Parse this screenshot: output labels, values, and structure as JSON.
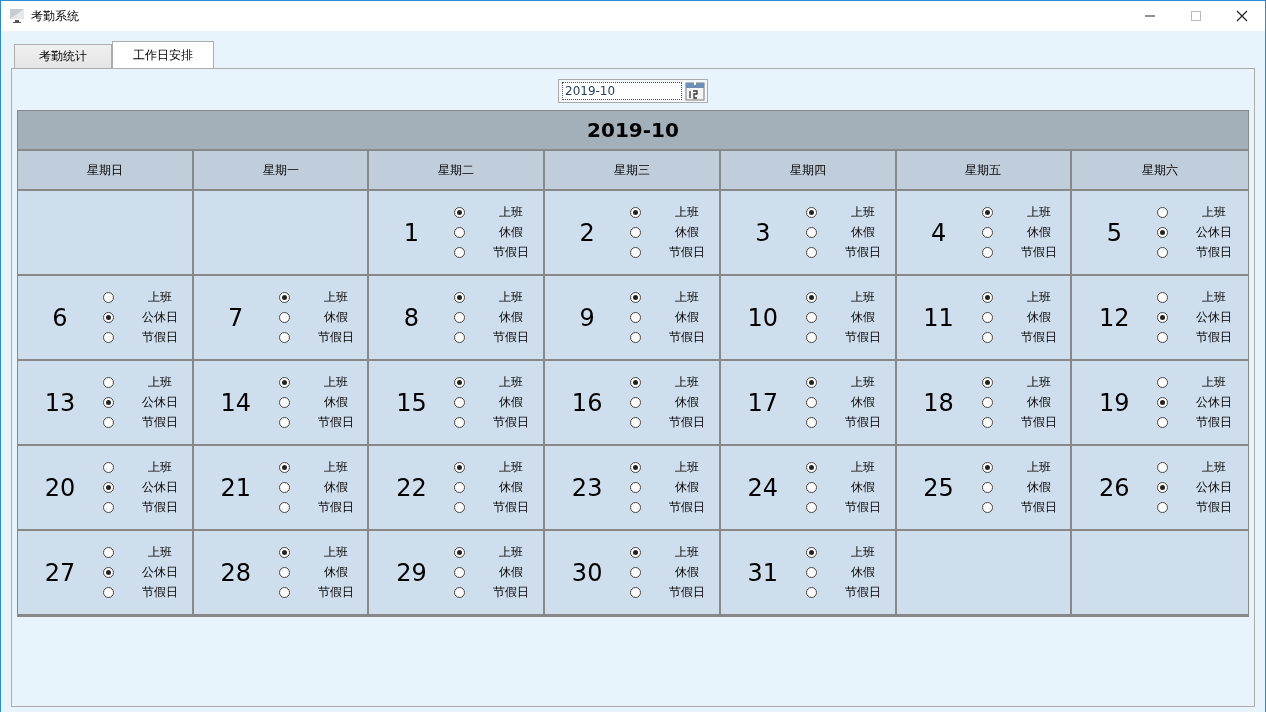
{
  "window": {
    "title": "考勤系统"
  },
  "tabs": [
    {
      "label": "考勤统计",
      "selected": false
    },
    {
      "label": "工作日安排",
      "selected": true
    }
  ],
  "month_picker": {
    "value": "2019-10"
  },
  "calendar": {
    "title": "2019-10",
    "weekdays": [
      "星期日",
      "星期一",
      "星期二",
      "星期三",
      "星期四",
      "星期五",
      "星期六"
    ],
    "cells": [
      {
        "kind": "blank"
      },
      {
        "kind": "blank"
      },
      {
        "kind": "day",
        "day": "1",
        "options": [
          {
            "label": "上班",
            "selected": true
          },
          {
            "label": "休假",
            "selected": false
          },
          {
            "label": "节假日",
            "selected": false
          }
        ]
      },
      {
        "kind": "day",
        "day": "2",
        "options": [
          {
            "label": "上班",
            "selected": true
          },
          {
            "label": "休假",
            "selected": false
          },
          {
            "label": "节假日",
            "selected": false
          }
        ]
      },
      {
        "kind": "day",
        "day": "3",
        "options": [
          {
            "label": "上班",
            "selected": true
          },
          {
            "label": "休假",
            "selected": false
          },
          {
            "label": "节假日",
            "selected": false
          }
        ]
      },
      {
        "kind": "day",
        "day": "4",
        "options": [
          {
            "label": "上班",
            "selected": true
          },
          {
            "label": "休假",
            "selected": false
          },
          {
            "label": "节假日",
            "selected": false
          }
        ]
      },
      {
        "kind": "day",
        "day": "5",
        "options": [
          {
            "label": "上班",
            "selected": false
          },
          {
            "label": "公休日",
            "selected": true
          },
          {
            "label": "节假日",
            "selected": false
          }
        ]
      },
      {
        "kind": "day",
        "day": "6",
        "options": [
          {
            "label": "上班",
            "selected": false
          },
          {
            "label": "公休日",
            "selected": true
          },
          {
            "label": "节假日",
            "selected": false
          }
        ]
      },
      {
        "kind": "day",
        "day": "7",
        "options": [
          {
            "label": "上班",
            "selected": true
          },
          {
            "label": "休假",
            "selected": false
          },
          {
            "label": "节假日",
            "selected": false
          }
        ]
      },
      {
        "kind": "day",
        "day": "8",
        "options": [
          {
            "label": "上班",
            "selected": true
          },
          {
            "label": "休假",
            "selected": false
          },
          {
            "label": "节假日",
            "selected": false
          }
        ]
      },
      {
        "kind": "day",
        "day": "9",
        "options": [
          {
            "label": "上班",
            "selected": true
          },
          {
            "label": "休假",
            "selected": false
          },
          {
            "label": "节假日",
            "selected": false
          }
        ]
      },
      {
        "kind": "day",
        "day": "10",
        "options": [
          {
            "label": "上班",
            "selected": true
          },
          {
            "label": "休假",
            "selected": false
          },
          {
            "label": "节假日",
            "selected": false
          }
        ]
      },
      {
        "kind": "day",
        "day": "11",
        "options": [
          {
            "label": "上班",
            "selected": true
          },
          {
            "label": "休假",
            "selected": false
          },
          {
            "label": "节假日",
            "selected": false
          }
        ]
      },
      {
        "kind": "day",
        "day": "12",
        "options": [
          {
            "label": "上班",
            "selected": false
          },
          {
            "label": "公休日",
            "selected": true
          },
          {
            "label": "节假日",
            "selected": false
          }
        ]
      },
      {
        "kind": "day",
        "day": "13",
        "options": [
          {
            "label": "上班",
            "selected": false
          },
          {
            "label": "公休日",
            "selected": true
          },
          {
            "label": "节假日",
            "selected": false
          }
        ]
      },
      {
        "kind": "day",
        "day": "14",
        "options": [
          {
            "label": "上班",
            "selected": true
          },
          {
            "label": "休假",
            "selected": false
          },
          {
            "label": "节假日",
            "selected": false
          }
        ]
      },
      {
        "kind": "day",
        "day": "15",
        "options": [
          {
            "label": "上班",
            "selected": true
          },
          {
            "label": "休假",
            "selected": false
          },
          {
            "label": "节假日",
            "selected": false
          }
        ]
      },
      {
        "kind": "day",
        "day": "16",
        "options": [
          {
            "label": "上班",
            "selected": true
          },
          {
            "label": "休假",
            "selected": false
          },
          {
            "label": "节假日",
            "selected": false
          }
        ]
      },
      {
        "kind": "day",
        "day": "17",
        "options": [
          {
            "label": "上班",
            "selected": true
          },
          {
            "label": "休假",
            "selected": false
          },
          {
            "label": "节假日",
            "selected": false
          }
        ]
      },
      {
        "kind": "day",
        "day": "18",
        "options": [
          {
            "label": "上班",
            "selected": true
          },
          {
            "label": "休假",
            "selected": false
          },
          {
            "label": "节假日",
            "selected": false
          }
        ]
      },
      {
        "kind": "day",
        "day": "19",
        "options": [
          {
            "label": "上班",
            "selected": false
          },
          {
            "label": "公休日",
            "selected": true
          },
          {
            "label": "节假日",
            "selected": false
          }
        ]
      },
      {
        "kind": "day",
        "day": "20",
        "options": [
          {
            "label": "上班",
            "selected": false
          },
          {
            "label": "公休日",
            "selected": true
          },
          {
            "label": "节假日",
            "selected": false
          }
        ]
      },
      {
        "kind": "day",
        "day": "21",
        "options": [
          {
            "label": "上班",
            "selected": true
          },
          {
            "label": "休假",
            "selected": false
          },
          {
            "label": "节假日",
            "selected": false
          }
        ]
      },
      {
        "kind": "day",
        "day": "22",
        "options": [
          {
            "label": "上班",
            "selected": true
          },
          {
            "label": "休假",
            "selected": false
          },
          {
            "label": "节假日",
            "selected": false
          }
        ]
      },
      {
        "kind": "day",
        "day": "23",
        "options": [
          {
            "label": "上班",
            "selected": true
          },
          {
            "label": "休假",
            "selected": false
          },
          {
            "label": "节假日",
            "selected": false
          }
        ]
      },
      {
        "kind": "day",
        "day": "24",
        "options": [
          {
            "label": "上班",
            "selected": true
          },
          {
            "label": "休假",
            "selected": false
          },
          {
            "label": "节假日",
            "selected": false
          }
        ]
      },
      {
        "kind": "day",
        "day": "25",
        "options": [
          {
            "label": "上班",
            "selected": true
          },
          {
            "label": "休假",
            "selected": false
          },
          {
            "label": "节假日",
            "selected": false
          }
        ]
      },
      {
        "kind": "day",
        "day": "26",
        "options": [
          {
            "label": "上班",
            "selected": false
          },
          {
            "label": "公休日",
            "selected": true
          },
          {
            "label": "节假日",
            "selected": false
          }
        ]
      },
      {
        "kind": "day",
        "day": "27",
        "options": [
          {
            "label": "上班",
            "selected": false
          },
          {
            "label": "公休日",
            "selected": true
          },
          {
            "label": "节假日",
            "selected": false
          }
        ]
      },
      {
        "kind": "day",
        "day": "28",
        "options": [
          {
            "label": "上班",
            "selected": true
          },
          {
            "label": "休假",
            "selected": false
          },
          {
            "label": "节假日",
            "selected": false
          }
        ]
      },
      {
        "kind": "day",
        "day": "29",
        "options": [
          {
            "label": "上班",
            "selected": true
          },
          {
            "label": "休假",
            "selected": false
          },
          {
            "label": "节假日",
            "selected": false
          }
        ]
      },
      {
        "kind": "day",
        "day": "30",
        "options": [
          {
            "label": "上班",
            "selected": true
          },
          {
            "label": "休假",
            "selected": false
          },
          {
            "label": "节假日",
            "selected": false
          }
        ]
      },
      {
        "kind": "day",
        "day": "31",
        "options": [
          {
            "label": "上班",
            "selected": true
          },
          {
            "label": "休假",
            "selected": false
          },
          {
            "label": "节假日",
            "selected": false
          }
        ]
      },
      {
        "kind": "blank"
      },
      {
        "kind": "blank"
      }
    ]
  }
}
